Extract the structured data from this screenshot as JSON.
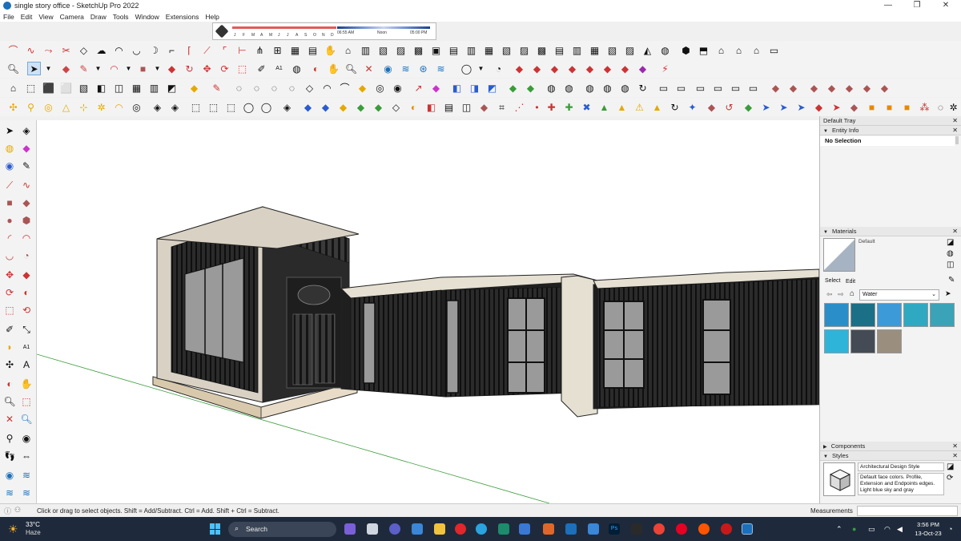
{
  "window": {
    "title": "single story office - SketchUp Pro 2022",
    "minimize_glyph": "—",
    "maximize_glyph": "❐",
    "close_glyph": "✕"
  },
  "menu": [
    "File",
    "Edit",
    "View",
    "Camera",
    "Draw",
    "Tools",
    "Window",
    "Extensions",
    "Help"
  ],
  "shadows": {
    "months": [
      "J",
      "F",
      "M",
      "A",
      "M",
      "J",
      "J",
      "A",
      "S",
      "O",
      "N",
      "D"
    ],
    "time_start": "06:55 AM",
    "time_mid": "Noon",
    "time_end": "05:00 PM"
  },
  "tray": {
    "title": "Default Tray",
    "entity_info": {
      "header": "Entity Info",
      "selection": "No Selection"
    },
    "materials": {
      "header": "Materials",
      "current": "Default",
      "tab_select": "Select",
      "tab_edit": "Edit",
      "collection": "Water",
      "swatch_colors": [
        "#2a8fc9",
        "#1b6f86",
        "#3d9ad8",
        "#2fa9c1",
        "#3aa3b8",
        "#2fb4d9",
        "#454b55",
        "#9a8e7e"
      ]
    },
    "components": {
      "header": "Components"
    },
    "styles": {
      "header": "Styles",
      "name": "Architectural Design Style",
      "description": "Default face colors. Profile, Extension and Endpoints edges. Light blue sky and gray"
    }
  },
  "status": {
    "message": "Click or drag to select objects. Shift = Add/Subtract. Ctrl = Add. Shift + Ctrl = Subtract.",
    "measurements_label": "Measurements"
  },
  "taskbar": {
    "temperature": "33°C",
    "weather": "Haze",
    "search_label": "Search",
    "time": "3:56 PM",
    "date": "13-Oct-23"
  }
}
